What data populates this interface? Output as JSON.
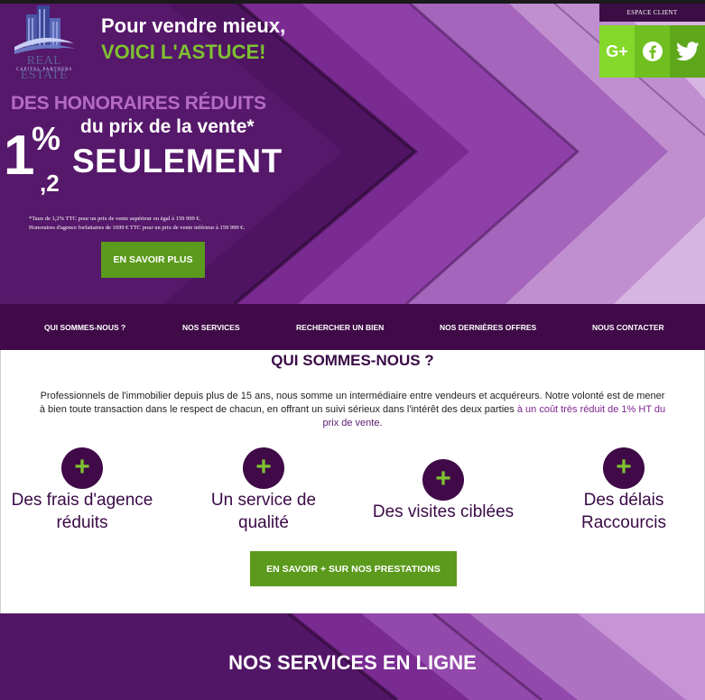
{
  "brand": {
    "name": "REAL ESTATE",
    "sub": "CAPITAL PARTNERS"
  },
  "hero": {
    "tagline_1": "Pour vendre mieux,",
    "tagline_2": "VOICI L'ASTUCE!",
    "honoraires": "DES HONORAIRES RÉDUITS",
    "rate_int": "1",
    "rate_pct": "%",
    "rate_dec": ",2",
    "prix": "du prix de la vente*",
    "seulement": "SEULEMENT",
    "note_1": "*Taux de 1,2% TTC pour un prix de vente supérieur ou égal à 159 999 €.",
    "note_2": "Honoraires d'agence forfaitaires de 1699 € TTC pour un prix de vente inférieur à 159 999 €.",
    "cta": "EN SAVOIR PLUS"
  },
  "header": {
    "espace_client": "ESPACE CLIENT",
    "social": [
      {
        "name": "google-plus",
        "label": "G+"
      },
      {
        "name": "facebook",
        "label": ""
      },
      {
        "name": "twitter",
        "label": ""
      }
    ]
  },
  "nav": {
    "items": [
      {
        "label": "QUI SOMMES-NOUS ?"
      },
      {
        "label": "NOS SERVICES"
      },
      {
        "label": "RECHERCHER UN BIEN"
      },
      {
        "label": "NOS DERNIÈRES OFFRES"
      },
      {
        "label": "NOUS CONTACTER"
      }
    ]
  },
  "about": {
    "title": "QUI SOMMES-NOUS ?",
    "para_line1": "Professionnels de l'immobilier depuis plus de 15 ans, nous somme un intermédiaire entre vendeurs et acquéreurs. Notre volonté est de mener",
    "para_line2_a": "à bien toute transaction dans le respect de chacun, en offrant un suivi sérieux dans l'intérêt des deux parties ",
    "para_line2_hl": "à un coût très réduit de 1% HT du",
    "para_line3": "prix de vente.",
    "features": [
      {
        "icon": "plus",
        "line1": "Des frais d'agence",
        "line2": "réduits"
      },
      {
        "icon": "plus",
        "line1": "Un service de",
        "line2": "qualité"
      },
      {
        "icon": "plus",
        "line1": "Des visites ciblées",
        "line2": ""
      },
      {
        "icon": "plus",
        "line1": "Des délais",
        "line2": "Raccourcis"
      }
    ],
    "plus_glyph": "+",
    "cta": "EN SAVOIR + SUR NOS PRESTATIONS"
  },
  "services": {
    "title": "NOS SERVICES EN LIGNE"
  },
  "colors": {
    "purple_dark": "#3f0a47",
    "purple_mid": "#5a1b6e",
    "purple_light": "#b56bc6",
    "green": "#5b9a1c",
    "green_light": "#7ec131"
  }
}
